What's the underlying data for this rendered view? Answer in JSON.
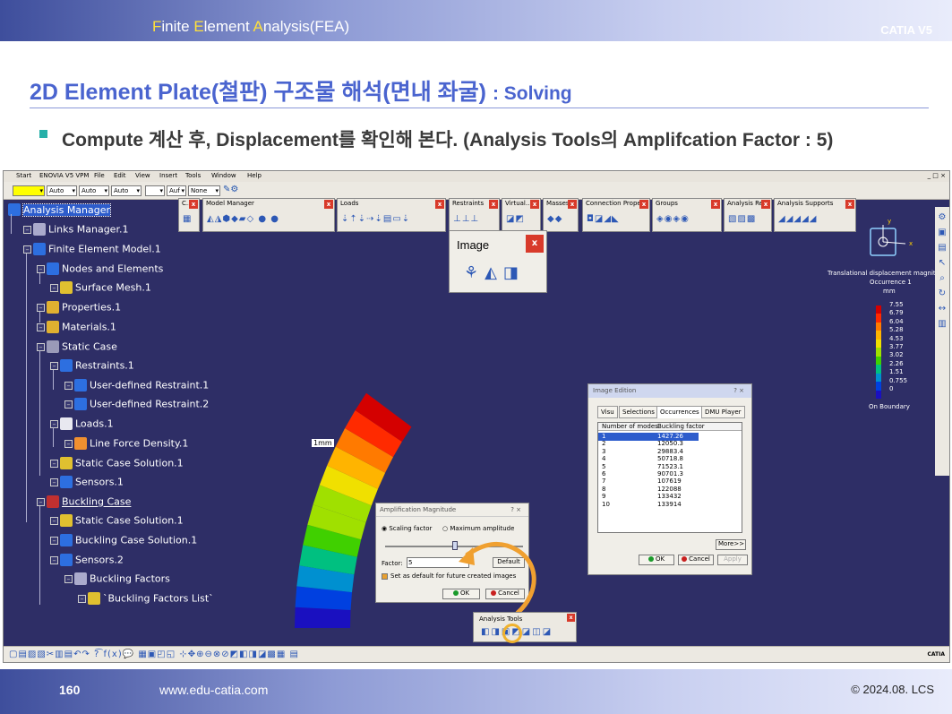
{
  "header": {
    "title_parts": [
      {
        "t": "F",
        "y": true
      },
      {
        "t": "inite ",
        "y": false
      },
      {
        "t": "E",
        "y": true
      },
      {
        "t": "lement ",
        "y": false
      },
      {
        "t": "A",
        "y": true
      },
      {
        "t": "nalysis(FEA)",
        "y": false
      }
    ],
    "brand": "CATIA V5"
  },
  "slide": {
    "heading_main": "2D Element Plate(철판) 구조물 해석(면내 좌굴) ",
    "heading_sub": ": Solving",
    "bullet": "Compute 계산 후, Displacement를 확인해 본다. (Analysis Tools의 Amplifcation Factor : 5)"
  },
  "menubar": {
    "items": [
      "Start",
      "ENOVIA V5 VPM",
      "File",
      "Edit",
      "View",
      "Insert",
      "Tools",
      "Window",
      "Help"
    ],
    "controls": "_ □ ×"
  },
  "toolbar1": {
    "combos": [
      "",
      "Auto",
      "Auto",
      "Auto",
      "",
      "Auf",
      "None"
    ]
  },
  "tree": [
    {
      "label": "Analysis Manager",
      "color": "#2d6fe0",
      "hl": true
    },
    {
      "label": "Links Manager.1",
      "color": "#aaaacc"
    },
    {
      "label": "Finite Element Model.1",
      "color": "#2d6fe0"
    },
    {
      "label": "Nodes and Elements",
      "color": "#2d6fe0"
    },
    {
      "label": "Surface Mesh.1",
      "color": "#e0c030"
    },
    {
      "label": "Properties.1",
      "color": "#e0b030"
    },
    {
      "label": "Materials.1",
      "color": "#e0b030"
    },
    {
      "label": "Static Case",
      "color": "#9a9ab8"
    },
    {
      "label": "Restraints.1",
      "color": "#2d6fe0"
    },
    {
      "label": "User-defined Restraint.1",
      "color": "#2d6fe0"
    },
    {
      "label": "User-defined Restraint.2",
      "color": "#2d6fe0"
    },
    {
      "label": "Loads.1",
      "color": "#e8e8f0"
    },
    {
      "label": "Line Force Density.1",
      "color": "#f09030"
    },
    {
      "label": "Static Case Solution.1",
      "color": "#e0c030"
    },
    {
      "label": "Sensors.1",
      "color": "#2d6fe0"
    },
    {
      "label": "Buckling Case",
      "color": "#c03030",
      "ul": true
    },
    {
      "label": "Static Case Solution.1",
      "color": "#e0c030"
    },
    {
      "label": "Buckling Case Solution.1",
      "color": "#2d6fe0"
    },
    {
      "label": "Sensors.2",
      "color": "#2d6fe0"
    },
    {
      "label": "Buckling Factors",
      "color": "#aaaacc"
    },
    {
      "label": "`Buckling Factors List`",
      "color": "#e0c030"
    }
  ],
  "toolbars": [
    {
      "title": "C...",
      "icons": "▦"
    },
    {
      "title": "Model Manager",
      "icons": "◭◮⬢◆▰◇ ● ●"
    },
    {
      "title": "Loads",
      "icons": "⇣⇡⇣⇢⇣▤▭⇣"
    },
    {
      "title": "Restraints",
      "icons": "⊥⊥⊥"
    },
    {
      "title": "Virtual...",
      "icons": "◪◩"
    },
    {
      "title": "Masses",
      "icons": "◆◆"
    },
    {
      "title": "Connection Prope...",
      "icons": "◘◪◢◣"
    },
    {
      "title": "Groups",
      "icons": "◈◉◈◉"
    },
    {
      "title": "Analysis Re...",
      "icons": "▧▨▩"
    },
    {
      "title": "Analysis Supports",
      "icons": "◢◢◢◢◢"
    }
  ],
  "image_toolbar": {
    "title": "Image",
    "icons": "⚘◭◨"
  },
  "viewport": {
    "mm_label": "1mm"
  },
  "legend": {
    "title": "Translational displacement magnit",
    "occurrence": "Occurrence 1",
    "unit": "mm",
    "values": [
      "7.55",
      "6.79",
      "6.04",
      "5.28",
      "4.53",
      "3.77",
      "3.02",
      "2.26",
      "1.51",
      "0.755",
      "0"
    ],
    "colors": [
      "#d40000",
      "#ff2a00",
      "#ff7a00",
      "#ffb400",
      "#f0e000",
      "#a0e000",
      "#40d000",
      "#00c080",
      "#0090d0",
      "#0040e0",
      "#1a10c0"
    ],
    "on_boundary": "On Boundary"
  },
  "axis": {
    "x": "x",
    "y": "y"
  },
  "image_edition": {
    "title": "Image Edition",
    "title_controls": "?    ×",
    "tabs": [
      "Visu",
      "Selections",
      "Occurrences",
      "DMU Player"
    ],
    "col_headers": [
      "Number of modes",
      "Buckling factor"
    ],
    "rows": [
      [
        "1",
        "1427.26"
      ],
      [
        "2",
        "12050.3"
      ],
      [
        "3",
        "29883.4"
      ],
      [
        "4",
        "50718.8"
      ],
      [
        "5",
        "71523.1"
      ],
      [
        "6",
        "90701.3"
      ],
      [
        "7",
        "107619"
      ],
      [
        "8",
        "122088"
      ],
      [
        "9",
        "133432"
      ],
      [
        "10",
        "133914"
      ]
    ],
    "more": "More>>",
    "ok": "OK",
    "cancel": "Cancel",
    "apply": "Apply"
  },
  "amp": {
    "title": "Amplification Magnitude",
    "title_controls": "?    ×",
    "scaling": "Scaling factor",
    "maximum": "Maximum amplitude",
    "factor_label": "Factor:",
    "factor_value": "5",
    "default": "Default",
    "set_default": "Set as default for future created images",
    "ok": "OK",
    "cancel": "Cancel"
  },
  "analysis_tools": {
    "title": "Analysis Tools",
    "icons": "◧◨▣◩◪◫◪"
  },
  "bottom_toolbar": {
    "icons": "▢▤▨▧✂▥▤↶↷ ?͡ f(x)💬 ▦▣◰◱ ⊹✥⊕⊖⊗⊘◩◧◨◪▩▦ ▤"
  },
  "catia_logo": "CATIA",
  "footer": {
    "page": "160",
    "url": "www.edu-catia.com",
    "copyright": "© 2024.08. LCS"
  }
}
